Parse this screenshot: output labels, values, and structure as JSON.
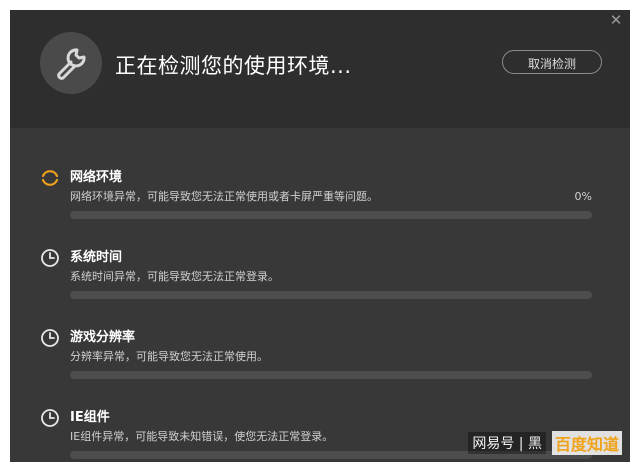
{
  "window": {
    "close_glyph": "✕",
    "title": "正在检测您的使用环境...",
    "cancel_label": "取消检测"
  },
  "items": [
    {
      "icon": "loading-spinner-icon",
      "title": "网络环境",
      "desc": "网络环境异常，可能导致您无法正常使用或者卡屏严重等问题。",
      "percent": "0%",
      "progress": 0
    },
    {
      "icon": "clock-icon",
      "title": "系统时间",
      "desc": "系统时间异常，可能导致您无法正常登录。",
      "progress": 0
    },
    {
      "icon": "clock-icon",
      "title": "游戏分辨率",
      "desc": "分辨率异常，可能导致您无法正常使用。",
      "progress": 0
    },
    {
      "icon": "clock-icon",
      "title": "IE组件",
      "desc": "IE组件异常，可能导致未知错误，使您无法正常登录。",
      "progress": 0
    }
  ],
  "watermark": {
    "text": "网易号 | 黑",
    "brand": "百度知道"
  },
  "colors": {
    "accent": "#f0a31a",
    "header_bg": "#2e2e2e",
    "body_bg": "#383838",
    "track": "#4d4d4d"
  }
}
